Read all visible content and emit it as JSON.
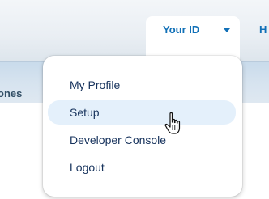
{
  "header": {
    "user_menu_label": "Your ID",
    "next_nav_fragment": "H",
    "tab_fragment": "ones"
  },
  "user_menu": {
    "items": [
      {
        "label": "My Profile"
      },
      {
        "label": "Setup",
        "hovered": true
      },
      {
        "label": "Developer Console"
      },
      {
        "label": "Logout"
      }
    ]
  },
  "cursor": {
    "type": "hand-pointer"
  },
  "colors": {
    "link_blue": "#1170b7",
    "menu_text": "#16325c",
    "hover_bg": "#e4f0fb"
  }
}
